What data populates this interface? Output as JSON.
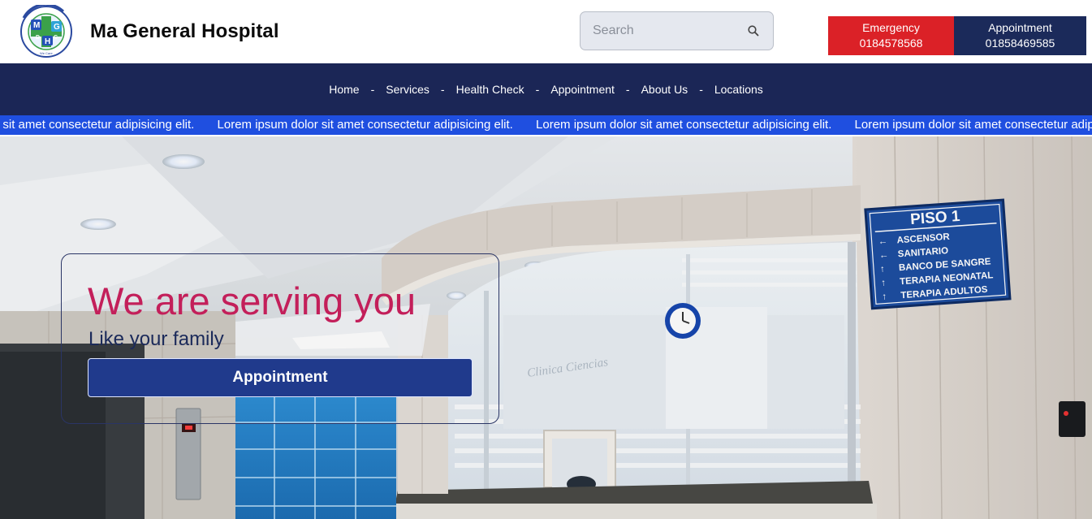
{
  "brand": {
    "name": "Ma General Hospital",
    "logo_letters": [
      "M",
      "G",
      "H",
      "D",
      "C"
    ],
    "logo_ring_text": "MA GENERAL HOSPITAL & DIAGNOSTIC CENTER",
    "logo_tagline": "We Care"
  },
  "search": {
    "placeholder": "Search",
    "icon": "search-icon"
  },
  "header_actions": {
    "emergency": {
      "label": "Emergency",
      "phone": "0184578568"
    },
    "appointment": {
      "label": "Appointment",
      "phone": "01858469585"
    }
  },
  "nav": {
    "separator": "-",
    "items": [
      "Home",
      "Services",
      "Health Check",
      "Appointment",
      "About Us",
      "Locations"
    ]
  },
  "ticker": {
    "items": [
      "Lorem ipsum dolor sit amet consectetur adipisicing elit.",
      "Lorem ipsum dolor sit amet consectetur adipisicing elit.",
      "Lorem ipsum dolor sit amet consectetur adipisicing elit.",
      "Lorem ipsum dolor sit amet consectetur adipisicing elit."
    ]
  },
  "hero": {
    "title": "We are serving you",
    "subtitle": "Like your family",
    "button_label": "Appointment",
    "sign": {
      "heading": "PISO 1",
      "lines": [
        "ASCENSOR",
        "SANITARIO",
        "BANCO DE SANGRE",
        "TERAPIA NEONATAL",
        "TERAPIA ADULTOS"
      ]
    },
    "glass_text": "Clinica Ciencias"
  },
  "colors": {
    "emergency": "#db2127",
    "navy": "#1b2656",
    "ticker": "#1f4fe0",
    "hero_title": "#c31f5a",
    "hero_button": "#203a8c"
  }
}
